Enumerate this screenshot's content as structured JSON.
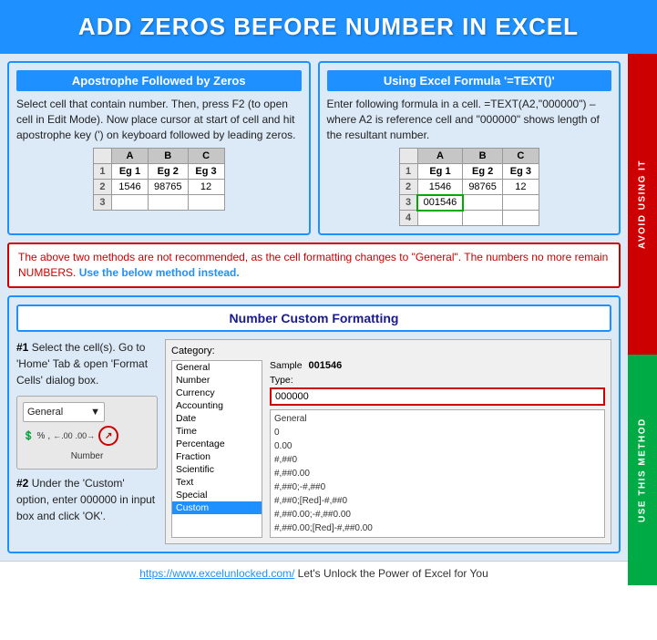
{
  "header": {
    "title": "ADD ZEROS BEFORE NUMBER IN EXCEL"
  },
  "panel_left": {
    "title": "Apostrophe Followed by Zeros",
    "text": "Select cell that contain number. Then, press F2 (to open cell in Edit Mode). Now place cursor at start of cell and hit apostrophe key (') on keyboard followed by leading zeros.",
    "table": {
      "headers": [
        "",
        "A",
        "B",
        "C"
      ],
      "rows": [
        [
          "1",
          "Eg 1",
          "Eg 2",
          "Eg 3"
        ],
        [
          "2",
          "1546",
          "98765",
          "12"
        ],
        [
          "3",
          "",
          "",
          ""
        ]
      ]
    }
  },
  "panel_right": {
    "title": "Using Excel Formula '=TEXT()'",
    "text": "Enter following formula in a cell. =TEXT(A2,\"000000\") – where A2 is reference cell and \"000000\" shows length of the resultant number.",
    "table": {
      "headers": [
        "",
        "A",
        "B",
        "C"
      ],
      "rows": [
        [
          "1",
          "Eg 1",
          "Eg 2",
          "Eg 3"
        ],
        [
          "2",
          "1546",
          "98765",
          "12"
        ],
        [
          "3",
          "001546",
          "",
          ""
        ],
        [
          "4",
          "",
          "",
          ""
        ]
      ]
    }
  },
  "warning": {
    "text1": "The above two methods are not recommended, as the cell formatting changes to \"General\". The numbers no more remain NUMBERS.",
    "text2": " Use the below method instead."
  },
  "bottom": {
    "title": "Number Custom Formatting",
    "step1": "#1 Select the cell(s). Go to 'Home' Tab & open 'Format Cells' dialog box.",
    "step2": "#2 Under the 'Custom' option, enter 000000 in input box and click 'OK'.",
    "format_cells": {
      "dropdown": "General",
      "label": "Number"
    },
    "dialog": {
      "category_label": "Category:",
      "categories": [
        "General",
        "Number",
        "Currency",
        "Accounting",
        "Date",
        "Time",
        "Percentage",
        "Fraction",
        "Scientific",
        "Text",
        "Special",
        "Custom"
      ],
      "selected_category": "Custom",
      "sample_label": "Sample",
      "sample_value": "001546",
      "type_label": "Type:",
      "type_value": "000000",
      "type_options": [
        "General",
        "0",
        "0.00",
        "#,##0",
        "#,##0.00",
        "#,##0;-#,##0",
        "#,##0;[Red]-#,##0",
        "#,##0.00;-#,##0.00",
        "#,##0.00;[Red]-#,##0.00"
      ]
    }
  },
  "side_tabs": {
    "avoid": "AVOID USING IT",
    "use": "USE THIS METHOD"
  },
  "footer": {
    "link_text": "https://www.excelunlocked.com/",
    "tagline": " Let's Unlock the Power of Excel for You"
  }
}
